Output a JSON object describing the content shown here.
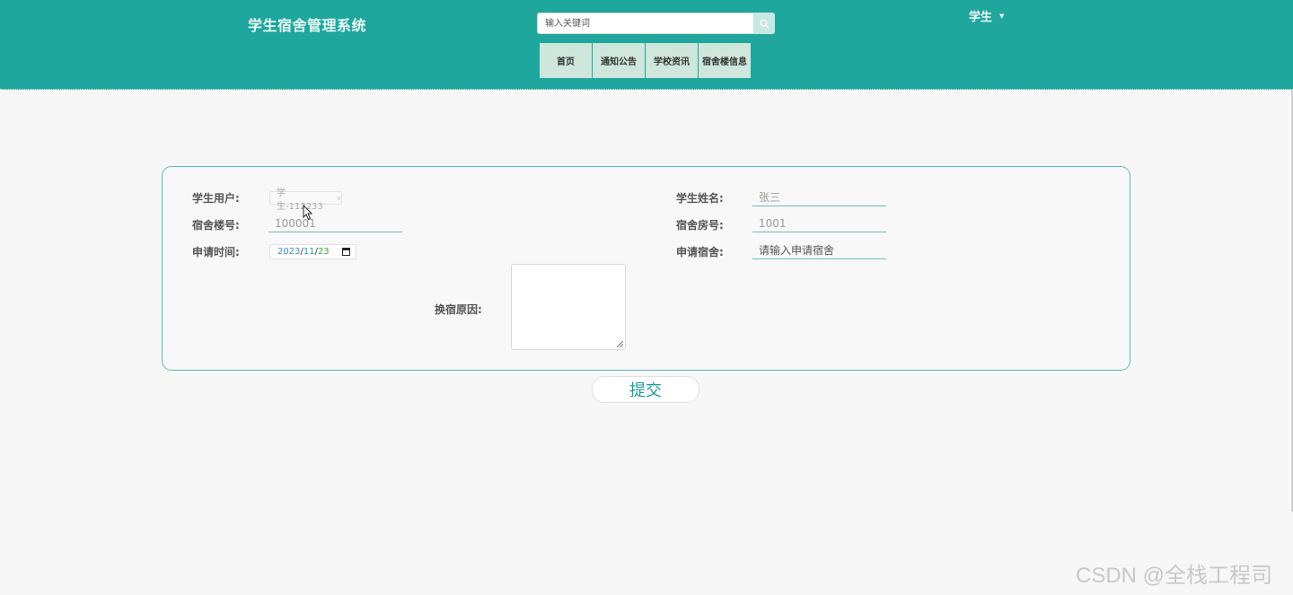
{
  "header": {
    "brand": "学生宿舍管理系统",
    "search_placeholder": "输入关键词",
    "user_label": "学生",
    "nav": [
      "首页",
      "通知公告",
      "学校资讯",
      "宿舍楼信息"
    ]
  },
  "form": {
    "student_user": {
      "label": "学生用户:",
      "value": "学生-112233"
    },
    "student_name": {
      "label": "学生姓名:",
      "value": "张三"
    },
    "building_no": {
      "label": "宿舍楼号:",
      "value": "100001"
    },
    "room_no": {
      "label": "宿舍房号:",
      "value": "1001"
    },
    "apply_time": {
      "label": "申请时间:",
      "year": "2023",
      "month": "11",
      "day": "23",
      "separator": "/"
    },
    "apply_dorm": {
      "label": "申请宿舍:",
      "placeholder": "请输入申请宿舍"
    },
    "reason": {
      "label": "换宿原因:",
      "value": ""
    }
  },
  "submit_label": "提交",
  "watermark": "CSDN @全栈工程司",
  "colors": {
    "header": "#1fa69d",
    "accent": "#1f9b95",
    "border": "#5cbab3"
  }
}
